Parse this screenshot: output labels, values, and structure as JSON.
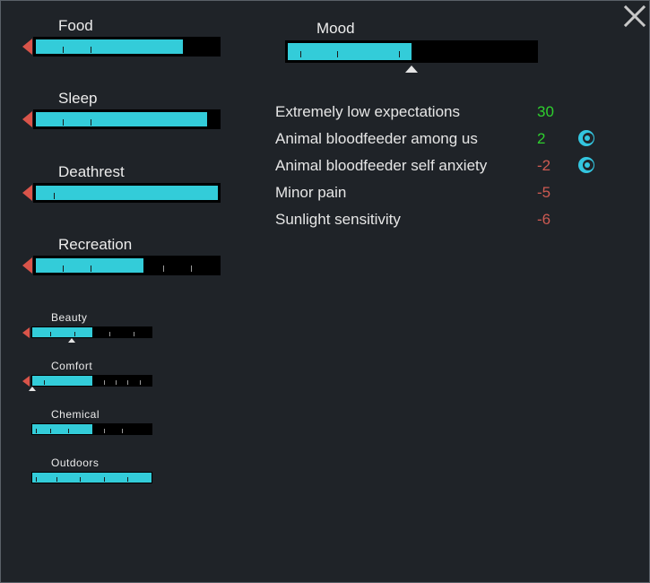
{
  "colors": {
    "background": "#1f2328",
    "bar_fill": "#33ccd9",
    "bar_empty": "#000000",
    "arrow_red": "#d9544a",
    "positive": "#2ecf2e",
    "negative": "#cd5a52"
  },
  "close_icon": "close-x-icon",
  "needs": [
    {
      "id": "food",
      "label": "Food",
      "level": 0.81,
      "thresholds": [
        0.15,
        0.3
      ],
      "arrow": "down",
      "size": "large"
    },
    {
      "id": "sleep",
      "label": "Sleep",
      "level": 0.94,
      "thresholds": [
        0.15,
        0.3
      ],
      "arrow": "down",
      "size": "large"
    },
    {
      "id": "deathrest",
      "label": "Deathrest",
      "level": 1.0,
      "thresholds": [
        0.1
      ],
      "arrow": "down",
      "size": "large"
    },
    {
      "id": "recreation",
      "label": "Recreation",
      "level": 0.59,
      "thresholds": [
        0.15,
        0.3,
        0.7,
        0.85
      ],
      "arrow": "down",
      "size": "large"
    },
    {
      "id": "beauty",
      "label": "Beauty",
      "level": 0.5,
      "thresholds": [
        0.15,
        0.35,
        0.65,
        0.85
      ],
      "arrow": "down",
      "size": "small",
      "current_marker": 0.33
    },
    {
      "id": "comfort",
      "label": "Comfort",
      "level": 0.5,
      "thresholds": [
        0.1,
        0.6,
        0.7,
        0.8,
        0.9
      ],
      "arrow": "down",
      "size": "small",
      "current_marker": 0.0
    },
    {
      "id": "chemical",
      "label": "Chemical",
      "level": 0.5,
      "thresholds": [
        0.03,
        0.15,
        0.3,
        0.6,
        0.75
      ],
      "arrow": "none",
      "size": "small"
    },
    {
      "id": "outdoors",
      "label": "Outdoors",
      "level": 1.0,
      "thresholds": [
        0.03,
        0.2,
        0.4,
        0.6,
        0.8
      ],
      "arrow": "none",
      "size": "small"
    }
  ],
  "mood": {
    "label": "Mood",
    "level": 0.5,
    "thresholds": [
      0.05,
      0.2,
      0.45
    ],
    "target": 0.5
  },
  "thoughts": [
    {
      "label": "Extremely low expectations",
      "value": "30",
      "sign": "positive",
      "icon": ""
    },
    {
      "label": "Animal bloodfeeder among us",
      "value": "2",
      "sign": "positive",
      "icon": "ideoligion-icon"
    },
    {
      "label": "Animal bloodfeeder self anxiety",
      "value": "-2",
      "sign": "negative",
      "icon": "ideoligion-icon"
    },
    {
      "label": "Minor pain",
      "value": "-5",
      "sign": "negative",
      "icon": ""
    },
    {
      "label": "Sunlight sensitivity",
      "value": "-6",
      "sign": "negative",
      "icon": ""
    }
  ]
}
